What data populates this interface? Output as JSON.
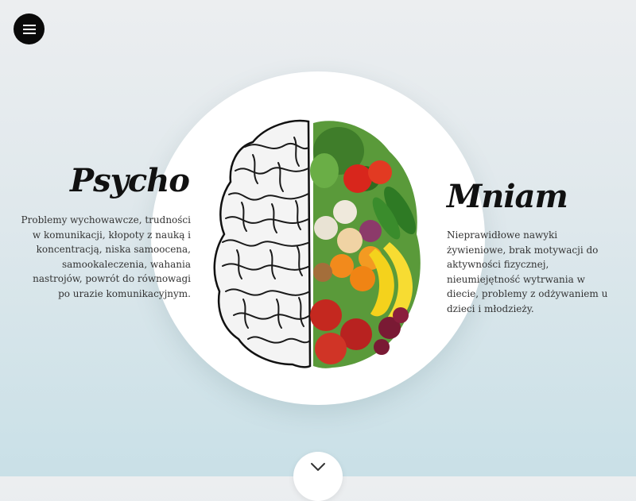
{
  "nav": {
    "menu_icon": "hamburger-menu-icon"
  },
  "hero": {
    "left": {
      "title": "Psycho",
      "description": "Problemy wychowawcze, trudności w komunikacji, kłopoty z nauką i koncentracją, niska samoocena, samookaleczenia, wahania nastrojów, powrót do równowagi po urazie komunikacyjnym."
    },
    "right": {
      "title": "Mniam",
      "description": "Nieprawidłowe nawyki żywieniowe, brak motywacji do aktywności fizycznej, nieumiejętność wytrwania w diecie, problemy z odżywaniem u dzieci i młodzieży."
    },
    "scroll_icon": "chevron-down-icon"
  },
  "colors": {
    "background_top": "#eceef0",
    "background_bottom": "#c9e0e7",
    "menu_button": "#0a0a0a",
    "circle": "#ffffff"
  }
}
